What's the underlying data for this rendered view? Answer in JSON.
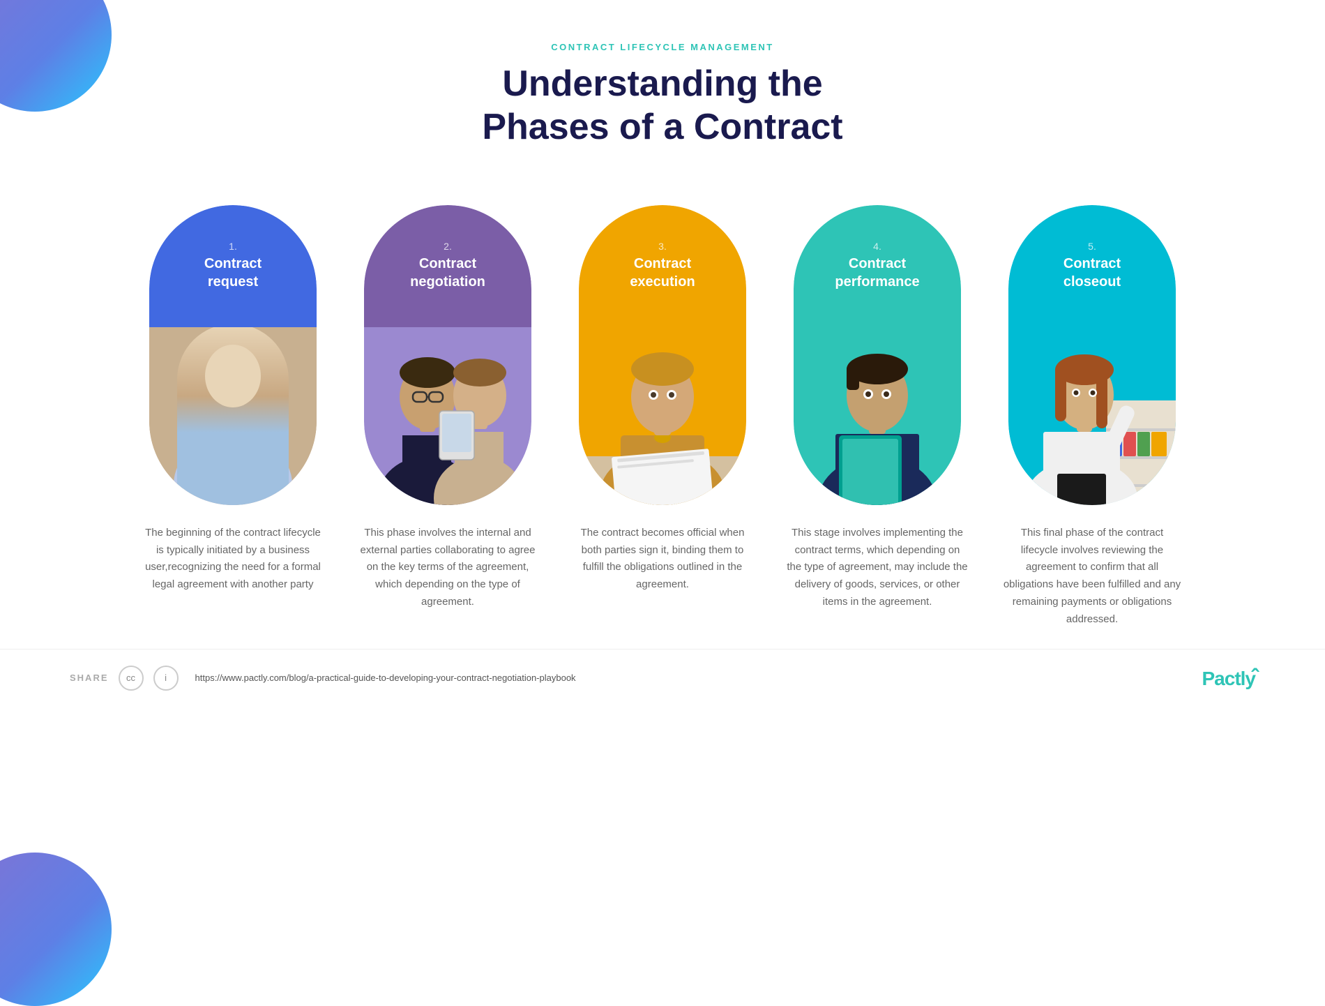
{
  "page": {
    "category": "CONTRACT LIFECYCLE MANAGEMENT",
    "title_line1": "Understanding the",
    "title_line2": "Phases of a Contract"
  },
  "phases": [
    {
      "number": "1.",
      "title_line1": "Contract",
      "title_line2": "request",
      "color": "#4169e1",
      "description": "The beginning of the contract lifecycle is typically initiated by a business user,recognizing the need for a formal legal agreement with another party",
      "person_style": "person-1"
    },
    {
      "number": "2.",
      "title_line1": "Contract",
      "title_line2": "negotiation",
      "color": "#7b5ea7",
      "description": "This phase involves the internal and external parties collaborating to agree on the key terms of the agreement, which depending on the type of agreement.",
      "person_style": "person-2"
    },
    {
      "number": "3.",
      "title_line1": "Contract",
      "title_line2": "execution",
      "color": "#f0a500",
      "description": "The contract becomes official when both parties sign it, binding them to fulfill the obligations outlined in the agreement.",
      "person_style": "person-3"
    },
    {
      "number": "4.",
      "title_line1": "Contract",
      "title_line2": "performance",
      "color": "#2ec4b6",
      "description": "This stage involves implementing the contract terms, which depending on the type of agreement, may include the delivery of goods, services, or other items in the agreement.",
      "person_style": "person-4"
    },
    {
      "number": "5.",
      "title_line1": "Contract",
      "title_line2": "closeout",
      "color": "#00bcd4",
      "description": "This final phase of the contract lifecycle involves reviewing the agreement to confirm that all obligations have been fulfilled and any remaining payments or obligations addressed.",
      "person_style": "person-5"
    }
  ],
  "footer": {
    "share_label": "SHARE",
    "cc_icon": "cc",
    "info_icon": "i",
    "url": "https://www.pactly.com/blog/a-practical-guide-to-developing-your-contract-negotiation-playbook",
    "logo_main": "Pactly",
    "logo_accent": "̂"
  }
}
